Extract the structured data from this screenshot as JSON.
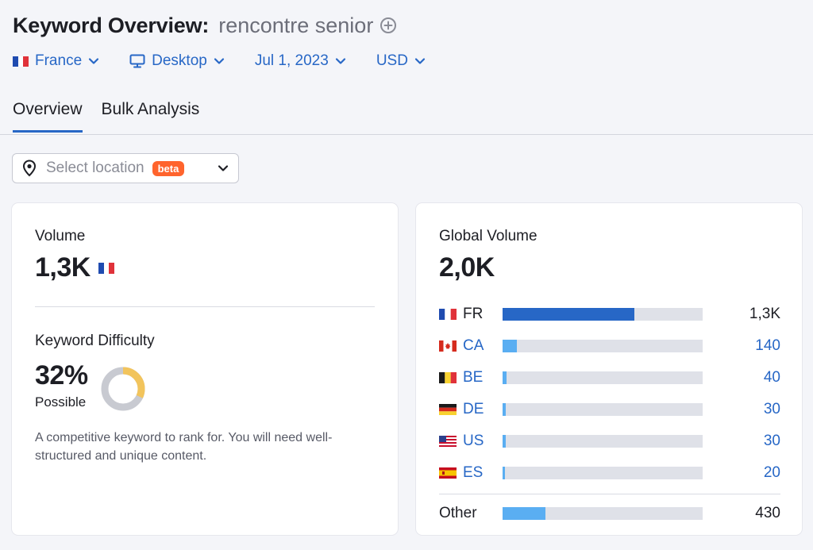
{
  "header": {
    "title": "Keyword Overview:",
    "keyword": "rencontre senior",
    "add_icon": "plus-circle-icon"
  },
  "filters": [
    {
      "label": "France",
      "icon": "france-flag-icon"
    },
    {
      "label": "Desktop",
      "icon": "desktop-monitor-icon"
    },
    {
      "label": "Jul 1, 2023"
    },
    {
      "label": "USD"
    }
  ],
  "tabs": [
    "Overview",
    "Bulk Analysis"
  ],
  "active_tab": "Overview",
  "location": {
    "placeholder": "Select location",
    "badge": "beta"
  },
  "volume": {
    "label": "Volume",
    "value": "1,3K",
    "country_flag": "france-flag-icon"
  },
  "keyword_difficulty": {
    "label": "Keyword Difficulty",
    "value": "32%",
    "level": "Possible",
    "percent": 32,
    "description": "A competitive keyword to rank for. You will need well-structured and unique content.",
    "colors": {
      "filled": "#f2c45c",
      "empty": "#c8cad1"
    }
  },
  "global_volume": {
    "label": "Global Volume",
    "value": "2,0K",
    "countries": [
      {
        "code": "FR",
        "value": "1,3K",
        "share": 0.66,
        "link": false,
        "flag": "france-flag-icon"
      },
      {
        "code": "CA",
        "value": "140",
        "share": 0.07,
        "link": true,
        "flag": "canada-flag-icon"
      },
      {
        "code": "BE",
        "value": "40",
        "share": 0.02,
        "link": true,
        "flag": "belgium-flag-icon"
      },
      {
        "code": "DE",
        "value": "30",
        "share": 0.015,
        "link": true,
        "flag": "germany-flag-icon"
      },
      {
        "code": "US",
        "value": "30",
        "share": 0.015,
        "link": true,
        "flag": "usa-flag-icon"
      },
      {
        "code": "ES",
        "value": "20",
        "share": 0.01,
        "link": true,
        "flag": "spain-flag-icon"
      }
    ],
    "other": {
      "label": "Other",
      "value": "430",
      "share": 0.215
    },
    "colors": {
      "primary": "#2767c6",
      "secondary": "#5aaef2",
      "track": "#dfe1e8"
    }
  }
}
